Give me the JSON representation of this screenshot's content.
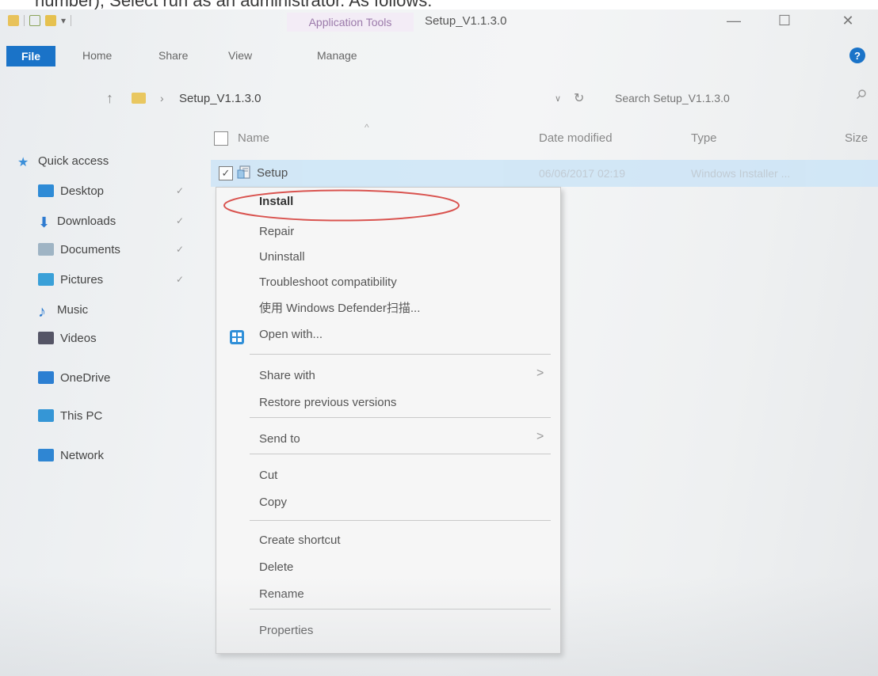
{
  "caption": {
    "text": "number), Select run as an administrator. As follows:"
  },
  "window": {
    "title": "Setup_V1.1.3.0",
    "contextual_tab_label": "Application Tools",
    "minimize_symbol": "—",
    "maximize_symbol": "☐",
    "close_symbol": "✕"
  },
  "ribbon": {
    "tabs": [
      "File",
      "Home",
      "Share",
      "View",
      "Manage"
    ],
    "help_symbol": "?"
  },
  "address": {
    "path": "Setup_V1.1.3.0",
    "search_placeholder": "Search Setup_V1.1.3.0",
    "up_symbol": "↑",
    "sep_symbol": "›",
    "dropdown_symbol": "∨",
    "refresh_symbol": "↻"
  },
  "columns": {
    "name": "Name",
    "date": "Date modified",
    "type": "Type",
    "size": "Size",
    "sort_symbol": "^"
  },
  "sidebar": {
    "pin_symbol": "✓",
    "items": [
      {
        "label": "Quick access",
        "icon": "star-icon",
        "color": "#3b8fd9",
        "pinned": false
      },
      {
        "label": "Desktop",
        "icon": "desktop-icon",
        "color": "#2e8bd6",
        "pinned": true
      },
      {
        "label": "Downloads",
        "icon": "download-icon",
        "color": "#2e7bd0",
        "pinned": true
      },
      {
        "label": "Documents",
        "icon": "documents-icon",
        "color": "#9fb4c4",
        "pinned": true
      },
      {
        "label": "Pictures",
        "icon": "pictures-icon",
        "color": "#3aa0d8",
        "pinned": true
      },
      {
        "label": "Music",
        "icon": "music-icon",
        "color": "#2e7bd0",
        "pinned": false
      },
      {
        "label": "Videos",
        "icon": "videos-icon",
        "color": "#556",
        "pinned": false
      },
      {
        "label": "OneDrive",
        "icon": "onedrive-icon",
        "color": "#2c7fd2",
        "pinned": false
      },
      {
        "label": "This PC",
        "icon": "this-pc-icon",
        "color": "#3596d6",
        "pinned": false
      },
      {
        "label": "Network",
        "icon": "network-icon",
        "color": "#2f86d3",
        "pinned": false
      }
    ]
  },
  "file": {
    "name": "Setup",
    "date_modified": "06/06/2017 02:19",
    "type": "Windows Installer ...",
    "check_symbol": "✓",
    "selected": true
  },
  "context_menu": {
    "submenu_symbol": ">",
    "items": [
      {
        "label": "Install",
        "bold": true
      },
      {
        "label": "Repair"
      },
      {
        "label": "Uninstall"
      },
      {
        "label": "Troubleshoot compatibility"
      },
      {
        "label": "使用 Windows Defender扫描..."
      },
      {
        "label": "Open with..."
      },
      {
        "label": "Share with",
        "submenu": true
      },
      {
        "label": "Restore previous versions"
      },
      {
        "label": "Send to",
        "submenu": true
      },
      {
        "label": "Cut"
      },
      {
        "label": "Copy"
      },
      {
        "label": "Create shortcut"
      },
      {
        "label": "Delete"
      },
      {
        "label": "Rename"
      },
      {
        "label": "Properties"
      }
    ]
  },
  "annotation": {
    "color": "#d9534f"
  }
}
